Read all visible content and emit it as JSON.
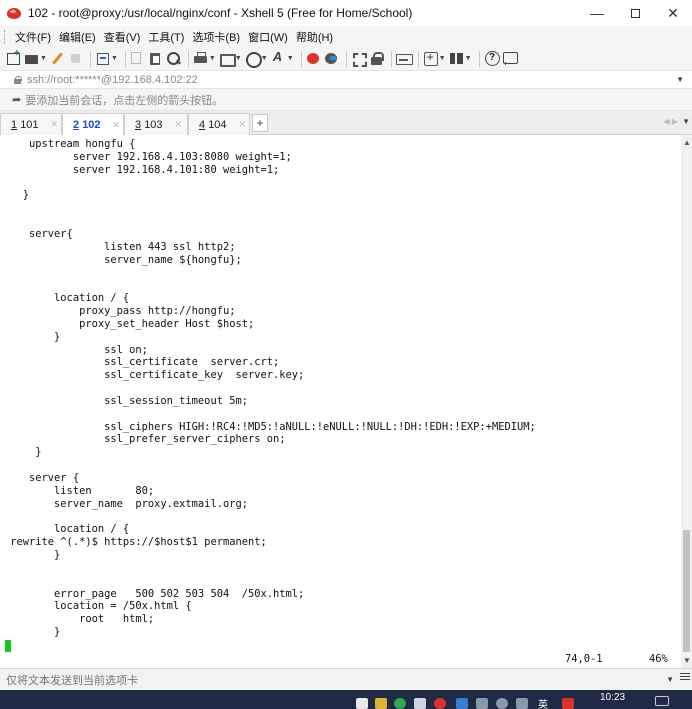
{
  "window": {
    "title": "102 - root@proxy:/usr/local/nginx/conf - Xshell 5 (Free for Home/School)",
    "minimize": "—",
    "close": "✕"
  },
  "menu": [
    {
      "label": "文件(F)"
    },
    {
      "label": "编辑(E)"
    },
    {
      "label": "查看(V)"
    },
    {
      "label": "工具(T)"
    },
    {
      "label": "选项卡(B)"
    },
    {
      "label": "窗口(W)"
    },
    {
      "label": "帮助(H)"
    }
  ],
  "address": {
    "text": "ssh://root:******@192.168.4.102:22"
  },
  "hint": {
    "text": "要添加当前会话，点击左侧的箭头按钮。"
  },
  "tabs": [
    {
      "num": "1",
      "label": "101"
    },
    {
      "num": "2",
      "label": "102"
    },
    {
      "num": "3",
      "label": "103"
    },
    {
      "num": "4",
      "label": "104"
    }
  ],
  "tab_add": "+",
  "terminal": {
    "lines": [
      "    upstream hongfu {",
      "           server 192.168.4.103:8080 weight=1;",
      "           server 192.168.4.101:80 weight=1;",
      "",
      "   }",
      "",
      "",
      "    server{",
      "                listen 443 ssl http2;",
      "                server_name ${hongfu};",
      "",
      "",
      "        location / {",
      "            proxy_pass http://hongfu;",
      "            proxy_set_header Host $host;",
      "        }",
      "                ssl on;",
      "                ssl_certificate  server.crt;",
      "                ssl_certificate_key  server.key;",
      "",
      "                ssl_session_timeout 5m;",
      "",
      "                ssl_ciphers HIGH:!RC4:!MD5:!aNULL:!eNULL:!NULL:!DH:!EDH:!EXP:+MEDIUM;",
      "                ssl_prefer_server_ciphers on;",
      "     }",
      "",
      "    server {",
      "        listen       80;",
      "        server_name  proxy.extmail.org;",
      "",
      "        location / {",
      " rewrite ^(.*)$ https://$host$1 permanent;",
      "        }",
      "",
      "",
      "        error_page   500 502 503 504  /50x.html;",
      "        location = /50x.html {",
      "            root   html;",
      "        }"
    ],
    "position": "74,0-1",
    "percent": "46%"
  },
  "sendbar": {
    "text": "仅将文本发送到当前选项卡"
  },
  "taskbar": {
    "time": "10:23",
    "ime": "英"
  },
  "colors": {
    "cursor": "#1ec41e",
    "tab_dot": "#19b519",
    "active_tab_text": "#1a4fc8",
    "taskbar": "#1f2a44"
  }
}
